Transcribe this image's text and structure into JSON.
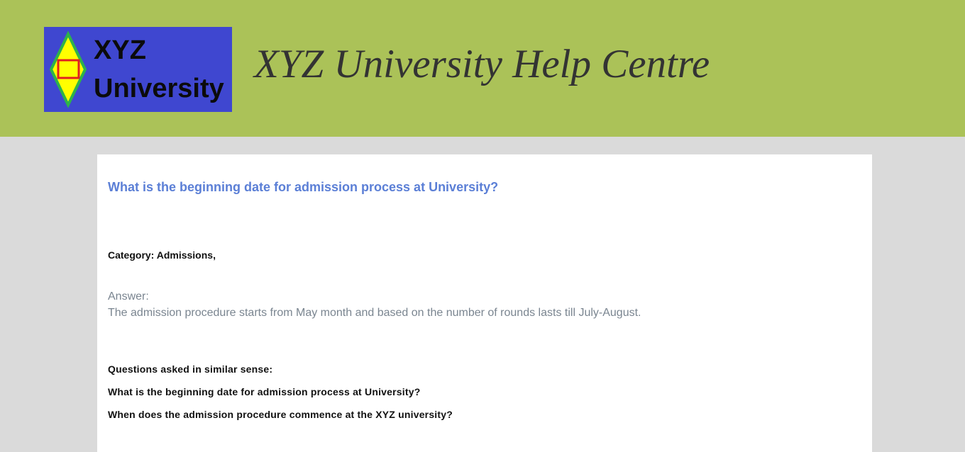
{
  "header": {
    "logo": {
      "line1": "XYZ",
      "line2": "University",
      "bg_color": "#3f47d0",
      "diamond_color": "#ffff00",
      "diamond_border": "#2db34a",
      "square_color": "#e02020"
    },
    "site_title": "XYZ University Help Centre",
    "bg_color": "#abc258"
  },
  "main": {
    "question_title": "What is the beginning date for admission process at University?",
    "category": "Category: Admissions,",
    "answer_label": "Answer:",
    "answer_text": "The admission procedure starts from May month and based on the number of rounds lasts till July-August.",
    "similar": {
      "heading": "Questions asked in similar sense:",
      "items": [
        "What is the beginning date for admission process at University?",
        "When does the admission procedure commence at the XYZ university?"
      ]
    }
  }
}
